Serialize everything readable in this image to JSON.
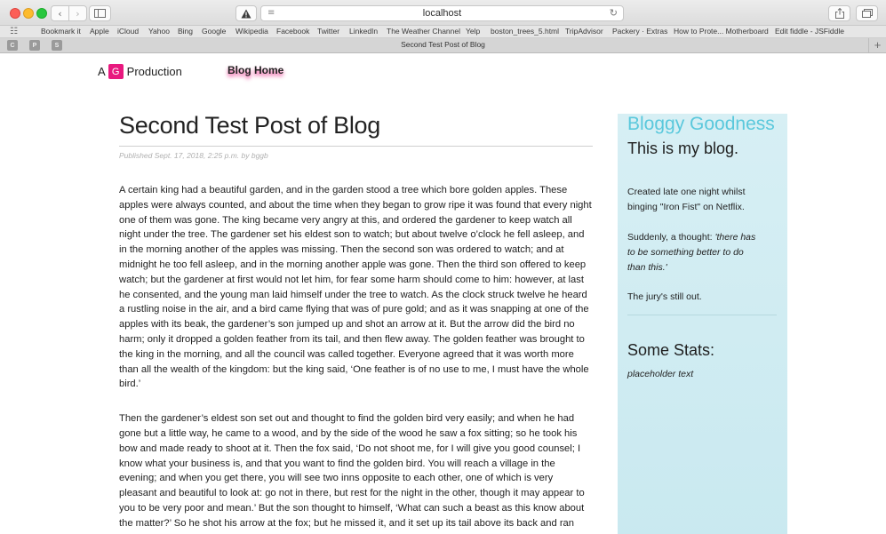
{
  "browser": {
    "url": "localhost",
    "tab_title": "Second Test Post of Blog",
    "new_tab_label": "+",
    "pinned_tabs": [
      "C",
      "P",
      "S"
    ],
    "icons": {
      "back": "chevron-left-icon",
      "forward": "chevron-right-icon",
      "sidebar": "sidebar-icon",
      "warning": "warning-icon",
      "reader": "reader-icon",
      "reload": "reload-icon",
      "share": "share-icon",
      "tabs": "tabs-overview-icon",
      "bookmarks_grid": "grid-icon"
    },
    "bookmarks": [
      "Bookmark it",
      "Apple",
      "iCloud",
      "Yahoo",
      "Bing",
      "Google",
      "Wikipedia",
      "Facebook",
      "Twitter",
      "LinkedIn",
      "The Weather Channel",
      "Yelp",
      "boston_trees_5.html",
      "TripAdvisor",
      "Packery · Extras",
      "How to Prote... Motherboard",
      "Edit fiddle - JSFiddle"
    ]
  },
  "site": {
    "brand_prefix": "A",
    "brand_letter": "G",
    "brand_suffix": "Production",
    "nav_home": "Blog Home",
    "accent": "#e8197f",
    "sidebar_title_color": "#5ac8dc"
  },
  "post": {
    "title": "Second Test Post of Blog",
    "meta": "Published Sept. 17, 2018, 2:25 p.m. by bggb",
    "paragraph_1": "A certain king had a beautiful garden, and in the garden stood a tree which bore golden apples. These apples were always counted, and about the time when they began to grow ripe it was found that every night one of them was gone. The king became very angry at this, and ordered the gardener to keep watch all night under the tree. The gardener set his eldest son to watch; but about twelve o’clock he fell asleep, and in the morning another of the apples was missing. Then the second son was ordered to watch; and at midnight he too fell asleep, and in the morning another apple was gone. Then the third son offered to keep watch; but the gardener at first would not let him, for fear some harm should come to him: however, at last he consented, and the young man laid himself under the tree to watch. As the clock struck twelve he heard a rustling noise in the air, and a bird came flying that was of pure gold; and as it was snapping at one of the apples with its beak, the gardener’s son jumped up and shot an arrow at it. But the arrow did the bird no harm; only it dropped a golden feather from its tail, and then flew away. The golden feather was brought to the king in the morning, and all the council was called together. Everyone agreed that it was worth more than all the wealth of the kingdom: but the king said, ‘One feather is of no use to me, I must have the whole bird.’",
    "paragraph_2": "Then the gardener’s eldest son set out and thought to find the golden bird very easily; and when he had gone but a little way, he came to a wood, and by the side of the wood he saw a fox sitting; so he took his bow and made ready to shoot at it. Then the fox said, ‘Do not shoot me, for I will give you good counsel; I know what your business is, and that you want to find the golden bird. You will reach a village in the evening; and when you get there, you will see two inns opposite to each other, one of which is very pleasant and beautiful to look at: go not in there, but rest for the night in the other, though it may appear to you to be very poor and mean.’ But the son thought to himself, ‘What can such a beast as this know about the matter?’ So he shot his arrow at the fox; but he missed it, and it set up its tail above its back and ran into the wood. Then he went his way, and in the evening came to the village where the two inns were; and in one of these were people singing, and dancing, and feasting; but the"
  },
  "sidebar": {
    "title": "Bloggy Goodness",
    "subtitle": "This is my blog.",
    "p1": "Created late one night whilst binging \"Iron Fist\" on Netflix.",
    "p2_prefix": "Suddenly, a thought: ",
    "p2_quote": "'there has to be something better to do than this.'",
    "p3": "The jury's still out.",
    "stats_title": "Some Stats:",
    "stats_placeholder": "placeholder text"
  }
}
